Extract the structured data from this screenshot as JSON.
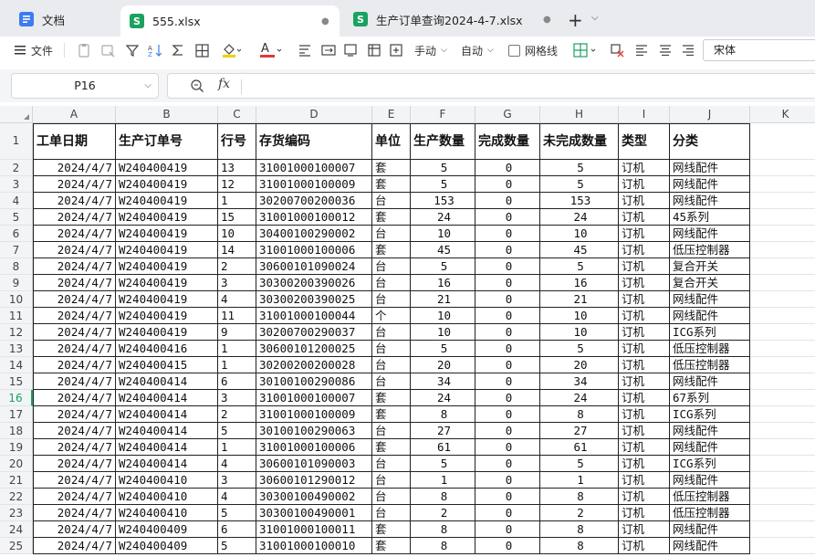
{
  "tabs": [
    {
      "label": "文档",
      "icon": "doc-icon"
    },
    {
      "label": "555.xlsx",
      "icon": "xls-icon",
      "badge": "●"
    },
    {
      "label": "生产订单查询2024-4-7.xlsx",
      "icon": "xls-icon",
      "badge": "●"
    }
  ],
  "icon_letters": {
    "doc": "",
    "xls": "S"
  },
  "new_tab": "+",
  "toolbar": {
    "file_label": "文件",
    "handwrite_label": "手动",
    "auto_label": "自动",
    "gridlines_label": "网格线",
    "font_name": "宋体"
  },
  "formula_bar": {
    "cell_ref": "P16",
    "fx": "fx",
    "content": ""
  },
  "columns": [
    "A",
    "B",
    "C",
    "D",
    "E",
    "F",
    "G",
    "H",
    "I",
    "J",
    "K"
  ],
  "header_row": [
    "工单日期",
    "生产订单号",
    "行号",
    "存货编码",
    "单位",
    "生产数量",
    "完成数量",
    "未完成数量",
    "类型",
    "分类"
  ],
  "row_numbers": [
    "1",
    "2",
    "3",
    "4",
    "5",
    "6",
    "7",
    "8",
    "9",
    "10",
    "11",
    "12",
    "13",
    "14",
    "15",
    "16",
    "17",
    "18",
    "19",
    "20",
    "21",
    "22",
    "23",
    "24",
    "25"
  ],
  "selected_row": "16",
  "rows": [
    [
      "2024/4/7",
      "W240400419",
      "13",
      "31001000100007",
      "套",
      "5",
      "0",
      "5",
      "订机",
      "网线配件"
    ],
    [
      "2024/4/7",
      "W240400419",
      "12",
      "31001000100009",
      "套",
      "5",
      "0",
      "5",
      "订机",
      "网线配件"
    ],
    [
      "2024/4/7",
      "W240400419",
      "1",
      "30200700200036",
      "台",
      "153",
      "0",
      "153",
      "订机",
      "网线配件"
    ],
    [
      "2024/4/7",
      "W240400419",
      "15",
      "31001000100012",
      "套",
      "24",
      "0",
      "24",
      "订机",
      "45系列"
    ],
    [
      "2024/4/7",
      "W240400419",
      "10",
      "30400100290002",
      "台",
      "10",
      "0",
      "10",
      "订机",
      "网线配件"
    ],
    [
      "2024/4/7",
      "W240400419",
      "14",
      "31001000100006",
      "套",
      "45",
      "0",
      "45",
      "订机",
      "低压控制器"
    ],
    [
      "2024/4/7",
      "W240400419",
      "2",
      "30600101090024",
      "台",
      "5",
      "0",
      "5",
      "订机",
      "复合开关"
    ],
    [
      "2024/4/7",
      "W240400419",
      "3",
      "30300200390026",
      "台",
      "16",
      "0",
      "16",
      "订机",
      "复合开关"
    ],
    [
      "2024/4/7",
      "W240400419",
      "4",
      "30300200390025",
      "台",
      "21",
      "0",
      "21",
      "订机",
      "网线配件"
    ],
    [
      "2024/4/7",
      "W240400419",
      "11",
      "31001000100044",
      "个",
      "10",
      "0",
      "10",
      "订机",
      "网线配件"
    ],
    [
      "2024/4/7",
      "W240400419",
      "9",
      "30200700290037",
      "台",
      "10",
      "0",
      "10",
      "订机",
      "ICG系列"
    ],
    [
      "2024/4/7",
      "W240400416",
      "1",
      "30600101200025",
      "台",
      "5",
      "0",
      "5",
      "订机",
      "低压控制器"
    ],
    [
      "2024/4/7",
      "W240400415",
      "1",
      "30200200200028",
      "台",
      "20",
      "0",
      "20",
      "订机",
      "低压控制器"
    ],
    [
      "2024/4/7",
      "W240400414",
      "6",
      "30100100290086",
      "台",
      "34",
      "0",
      "34",
      "订机",
      "网线配件"
    ],
    [
      "2024/4/7",
      "W240400414",
      "3",
      "31001000100007",
      "套",
      "24",
      "0",
      "24",
      "订机",
      "67系列"
    ],
    [
      "2024/4/7",
      "W240400414",
      "2",
      "31001000100009",
      "套",
      "8",
      "0",
      "8",
      "订机",
      "ICG系列"
    ],
    [
      "2024/4/7",
      "W240400414",
      "5",
      "30100100290063",
      "台",
      "27",
      "0",
      "27",
      "订机",
      "网线配件"
    ],
    [
      "2024/4/7",
      "W240400414",
      "1",
      "31001000100006",
      "套",
      "61",
      "0",
      "61",
      "订机",
      "网线配件"
    ],
    [
      "2024/4/7",
      "W240400414",
      "4",
      "30600101090003",
      "台",
      "5",
      "0",
      "5",
      "订机",
      "ICG系列"
    ],
    [
      "2024/4/7",
      "W240400410",
      "3",
      "30600101290012",
      "台",
      "1",
      "0",
      "1",
      "订机",
      "网线配件"
    ],
    [
      "2024/4/7",
      "W240400410",
      "4",
      "30300100490002",
      "台",
      "8",
      "0",
      "8",
      "订机",
      "低压控制器"
    ],
    [
      "2024/4/7",
      "W240400410",
      "5",
      "30300100490001",
      "台",
      "2",
      "0",
      "2",
      "订机",
      "低压控制器"
    ],
    [
      "2024/4/7",
      "W240400409",
      "6",
      "31001000100011",
      "套",
      "8",
      "0",
      "8",
      "订机",
      "网线配件"
    ],
    [
      "2024/4/7",
      "W240400409",
      "5",
      "31001000100010",
      "套",
      "8",
      "0",
      "8",
      "订机",
      "网线配件"
    ]
  ]
}
